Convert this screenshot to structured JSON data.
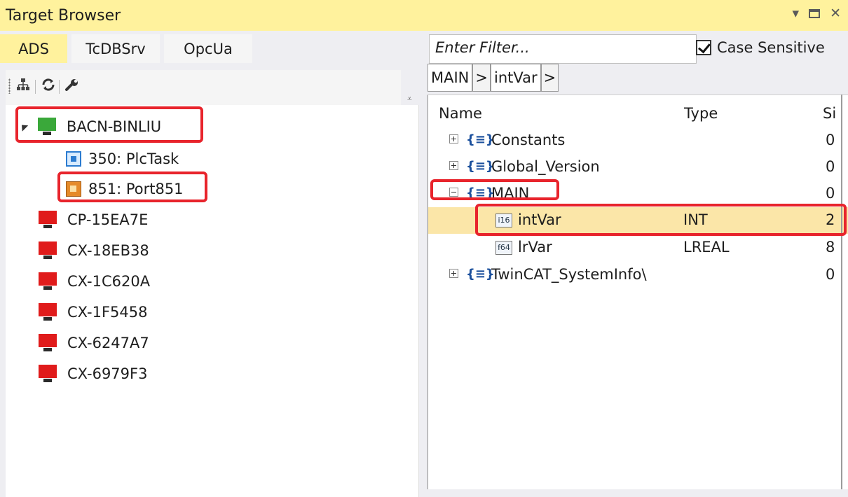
{
  "window": {
    "title": "Target Browser"
  },
  "tabs": [
    {
      "label": "ADS",
      "active": true
    },
    {
      "label": "TcDBSrv",
      "active": false
    },
    {
      "label": "OpcUa",
      "active": false
    }
  ],
  "toolbar": {
    "icons": [
      "network-tree-icon",
      "refresh-icon",
      "wrench-icon"
    ]
  },
  "targets": [
    {
      "label": "BACN-BINLIU",
      "status": "online",
      "color": "#3aa83a",
      "expanded": true
    },
    {
      "label": "350: PlcTask",
      "kind": "task"
    },
    {
      "label": "851: Port851",
      "kind": "port"
    },
    {
      "label": "CP-15EA7E",
      "status": "offline",
      "color": "#e01b1b"
    },
    {
      "label": "CX-18EB38",
      "status": "offline",
      "color": "#e01b1b"
    },
    {
      "label": "CX-1C620A",
      "status": "offline",
      "color": "#e01b1b"
    },
    {
      "label": "CX-1F5458",
      "status": "offline",
      "color": "#e01b1b"
    },
    {
      "label": "CX-6247A7",
      "status": "offline",
      "color": "#e01b1b"
    },
    {
      "label": "CX-6979F3",
      "status": "offline",
      "color": "#e01b1b"
    }
  ],
  "filter": {
    "placeholder": "Enter Filter...",
    "case_sensitive_label": "Case Sensitive",
    "case_sensitive": true
  },
  "breadcrumb": [
    {
      "label": "MAIN"
    },
    {
      "label": ">"
    },
    {
      "label": "intVar"
    },
    {
      "label": ">"
    }
  ],
  "symbols": {
    "columns": {
      "name": "Name",
      "type": "Type",
      "size": "Si"
    },
    "rows": [
      {
        "name": "Constants",
        "type": "",
        "size": "0",
        "icon": "{≡}",
        "expander": "plus"
      },
      {
        "name": "Global_Version",
        "type": "",
        "size": "0",
        "icon": "{≡}",
        "expander": "plus"
      },
      {
        "name": "MAIN",
        "type": "",
        "size": "0",
        "icon": "{≡}",
        "expander": "minus"
      },
      {
        "name": "intVar",
        "type": "INT",
        "size": "2",
        "icon": "i16",
        "selected": true
      },
      {
        "name": "lrVar",
        "type": "LREAL",
        "size": "8",
        "icon": "f64"
      },
      {
        "name": "TwinCAT_SystemInfo\\",
        "type": "",
        "size": "0",
        "icon": "{≡}",
        "expander": "plus"
      }
    ]
  },
  "colors": {
    "highlight": "#fff29d",
    "selection": "#fbe6a8",
    "annotation": "#e8242c"
  }
}
